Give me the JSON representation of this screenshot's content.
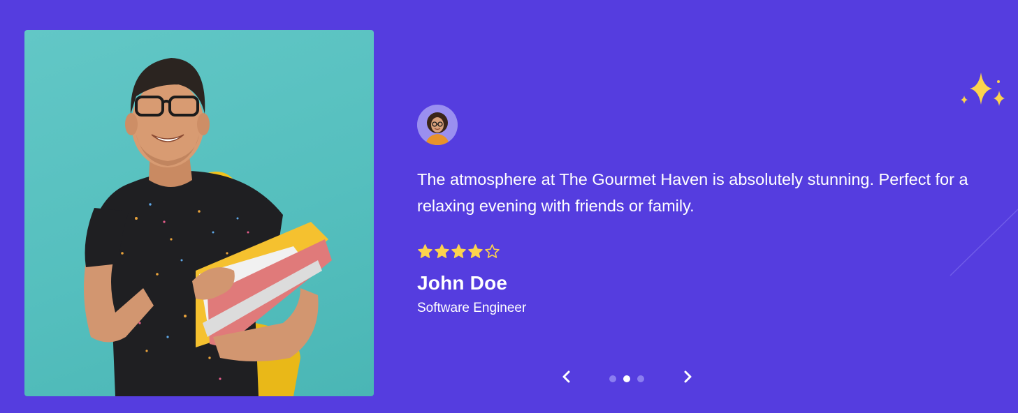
{
  "testimonial": {
    "quote": "The atmosphere at The Gourmet Haven is absolutely stunning. Perfect for a relaxing evening with friends or family.",
    "rating": 4,
    "rating_max": 5,
    "author_name": "John Doe",
    "author_role": "Software Engineer"
  },
  "carousel": {
    "prev_icon": "chevron-left-icon",
    "next_icon": "chevron-right-icon",
    "slide_count": 3,
    "active_index": 1
  },
  "colors": {
    "background": "#553ddf",
    "star": "#fcd34d",
    "text": "#ffffff",
    "dot_inactive": "#8b7ef0",
    "dot_active": "#ffffff"
  }
}
